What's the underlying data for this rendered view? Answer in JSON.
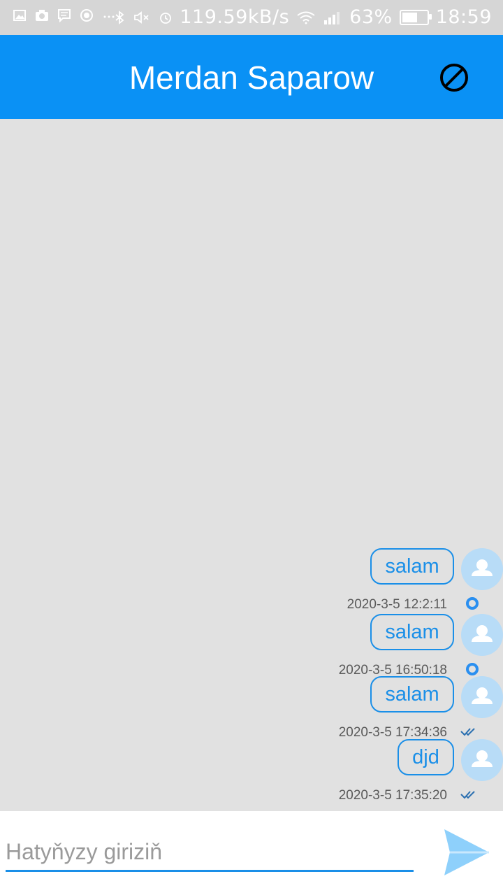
{
  "status_bar": {
    "network_speed": "119.59kB/s",
    "battery_percent": "63%",
    "battery_level": 0.63,
    "time": "18:59",
    "icons": [
      "image-icon",
      "camera-icon",
      "message-icon",
      "record-icon",
      "more-icon",
      "bluetooth-icon",
      "mute-icon",
      "alarm-icon",
      "wifi-icon",
      "signal-icon",
      "battery-icon"
    ]
  },
  "header": {
    "title": "Merdan Saparow",
    "action_icon": "block-icon"
  },
  "messages": [
    {
      "text": "salam",
      "timestamp": "2020-3-5 12:2:11",
      "status": "pending"
    },
    {
      "text": "salam",
      "timestamp": "2020-3-5 16:50:18",
      "status": "pending"
    },
    {
      "text": "salam",
      "timestamp": "2020-3-5 17:34:36",
      "status": "read"
    },
    {
      "text": "djd",
      "timestamp": "2020-3-5 17:35:20",
      "status": "read"
    }
  ],
  "input": {
    "placeholder": "Hatyňyzy giriziň",
    "value": ""
  },
  "colors": {
    "accent": "#0a91f5",
    "bubble_border": "#1a8fe8",
    "chat_background": "#e1e1e1",
    "avatar_background": "#b8dcf7"
  }
}
